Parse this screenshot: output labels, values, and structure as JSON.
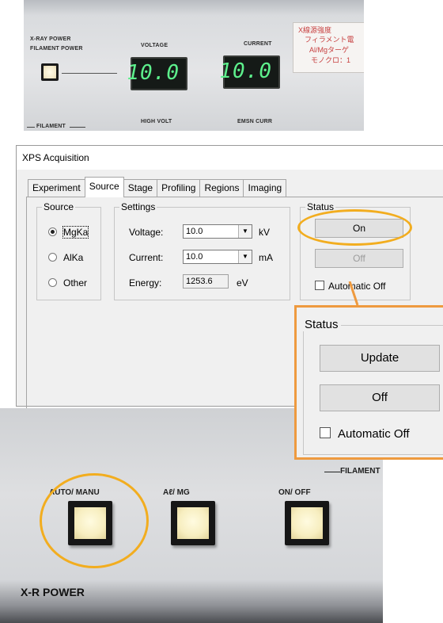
{
  "photo_top": {
    "xray_power": "X-RAY POWER",
    "filament_power": "FILAMENT POWER",
    "voltage_label": "VOLTAGE",
    "current_label": "CURRENT",
    "voltage_display": "10.0",
    "current_display": "10.0",
    "filament_label": "FILAMENT",
    "high_volt": "HIGH VOLT",
    "emsn_curr": "EMSN CURR",
    "jp_lines": [
      "X線源強度",
      "フィラメント電",
      "Al/Mgターゲ",
      "モノクロ：1"
    ]
  },
  "window": {
    "title": "XPS Acquisition",
    "tabs": [
      "Experiment",
      "Source",
      "Stage",
      "Profiling",
      "Regions",
      "Imaging"
    ],
    "active_tab": "Source",
    "source_group": {
      "title": "Source",
      "options": [
        "MgKa",
        "AlKa",
        "Other"
      ],
      "selected": "MgKa"
    },
    "settings_group": {
      "title": "Settings",
      "voltage_label": "Voltage:",
      "voltage_value": "10.0",
      "voltage_unit": "kV",
      "current_label": "Current:",
      "current_value": "10.0",
      "current_unit": "mA",
      "energy_label": "Energy:",
      "energy_value": "1253.6",
      "energy_unit": "eV"
    },
    "status_group": {
      "title": "Status",
      "on_button": "On",
      "off_button": "Off",
      "auto_off_label": "Automatic Off"
    }
  },
  "inset": {
    "title": "Status",
    "update_button": "Update",
    "off_button": "Off",
    "auto_off_label": "Automatic Off"
  },
  "photo_bottom": {
    "auto_manu": "AUTO/ MANU",
    "al_mg": "Aℓ/ MG",
    "on_off": "ON/ OFF",
    "filament": "FILAMENT",
    "xr_power": "X-R POWER"
  },
  "colors": {
    "callout_orange": "#ee9a3f",
    "highlight_yellow": "#f2ad1f",
    "lcd_green": "#5df08c"
  }
}
